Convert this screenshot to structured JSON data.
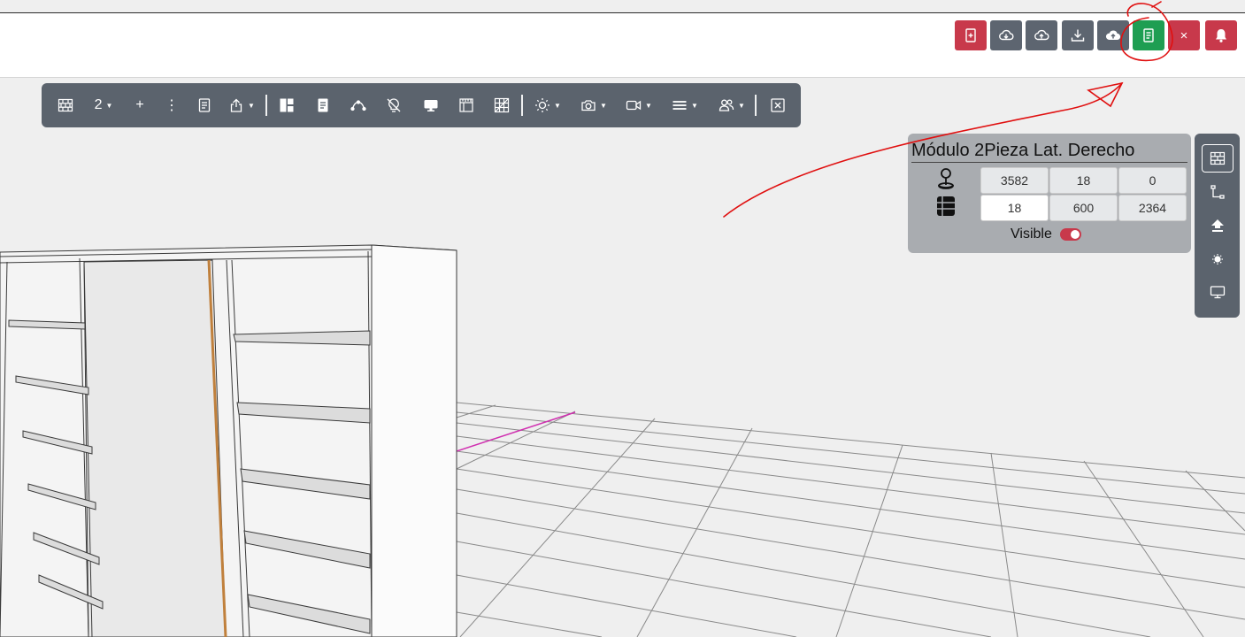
{
  "header": {
    "buttons": [
      {
        "id": "new-doc",
        "icon": "file-plus-icon",
        "color": "#c8394b"
      },
      {
        "id": "cloud-download",
        "icon": "cloud-download-icon",
        "color": "#5d6570"
      },
      {
        "id": "cloud-upload",
        "icon": "cloud-upload-icon",
        "color": "#5d6570"
      },
      {
        "id": "download",
        "icon": "download-icon",
        "color": "#5d6570"
      },
      {
        "id": "cloud-upload-filled",
        "icon": "cloud-upload-filled-icon",
        "color": "#5d6570"
      },
      {
        "id": "document",
        "icon": "document-icon",
        "color": "#1e9e52"
      },
      {
        "id": "close",
        "icon": "close-icon",
        "color": "#c8394b",
        "label": "×"
      },
      {
        "id": "notifications",
        "icon": "bell-icon",
        "color": "#c8394b"
      }
    ]
  },
  "toolbar": {
    "wall_icon": "wall-icon",
    "level_value": "2",
    "add_label": "+",
    "more_label": "⋮",
    "items": [
      "wall-icon",
      "level-dropdown",
      "add-icon",
      "more-icon",
      "document-icon",
      "share-icon",
      "layout-icon",
      "page-icon",
      "curve-icon",
      "lightbulb-off-icon",
      "monitor-icon",
      "ruler-icon",
      "grid-icon",
      "sun-icon",
      "camera-icon",
      "video-icon",
      "lines-icon",
      "users-icon",
      "close-box-icon"
    ]
  },
  "panel": {
    "title": "Módulo 2Pieza Lat. Derecho",
    "position": {
      "x": "3582",
      "y": "18",
      "z": "0"
    },
    "dimensions": {
      "w": "18",
      "d": "600",
      "h": "2364"
    },
    "visible_label": "Visible",
    "visible": true
  },
  "sidebar": {
    "items": [
      "wall-icon",
      "node-path-icon",
      "upload-arrow-icon",
      "sun-small-icon",
      "monitor-icon"
    ],
    "active": "wall-icon"
  },
  "colors": {
    "accent_red": "#c8394b",
    "accent_green": "#1e9e52",
    "toolbar_gray": "#5b636d",
    "annotation": "#e01010",
    "grid_highlight": "#d030b0"
  }
}
